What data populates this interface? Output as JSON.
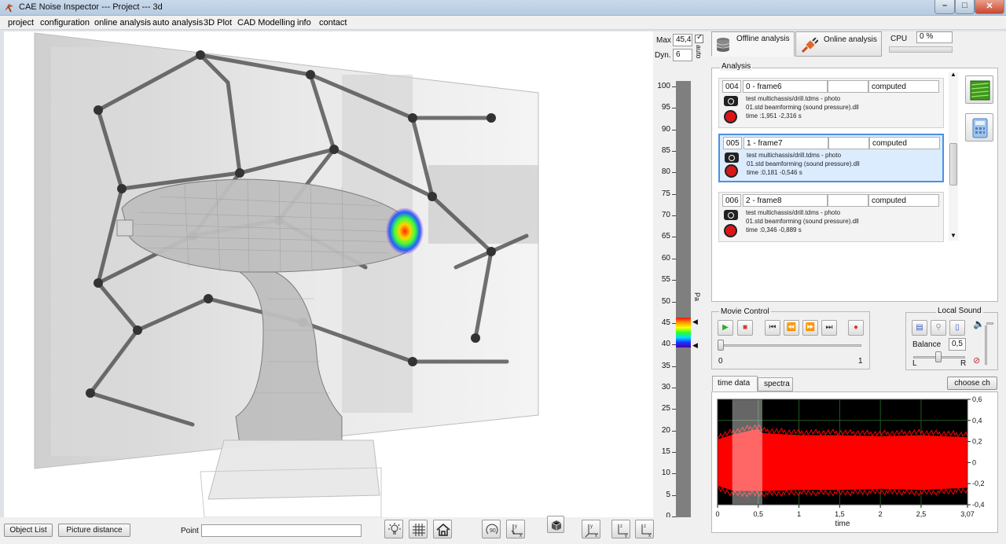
{
  "window": {
    "title": "CAE Noise Inspector --- Project ---  3d",
    "min_glyph": "–",
    "max_glyph": "□",
    "close_glyph": "✕"
  },
  "menu": [
    "project",
    "configuration",
    "online analysis",
    "auto analysis",
    "3D Plot",
    "CAD Modelling",
    "info",
    "contact"
  ],
  "scale": {
    "max_label": "Max",
    "max_value": "45,4",
    "dyn_label": "Dyn.",
    "dyn_value": "6",
    "auto_label": "auto",
    "unit": "Pa",
    "ticks": [
      "100",
      "95",
      "90",
      "85",
      "80",
      "75",
      "70",
      "65",
      "60",
      "55",
      "50",
      "45",
      "40",
      "35",
      "30",
      "25",
      "20",
      "15",
      "10",
      "5",
      "0"
    ]
  },
  "tabs": {
    "offline": "Offline analysis",
    "online": "Online analysis",
    "cpu_label": "CPU",
    "cpu_value": "0 %"
  },
  "analysis": {
    "title": "Analysis",
    "items": [
      {
        "id": "004",
        "name": "0 - frame6",
        "status": "computed",
        "line1": "test multichassis/drill.tdms - photo",
        "line2": "01.std beamforming (sound pressure).dll",
        "line3": "time :1,951 -2,316 s"
      },
      {
        "id": "005",
        "name": "1 - frame7",
        "status": "computed",
        "line1": "test multichassis/drill.tdms - photo",
        "line2": "01.std beamforming (sound pressure).dll",
        "line3": "time :0,181 -0,546 s"
      },
      {
        "id": "006",
        "name": "2 - frame8",
        "status": "computed",
        "line1": "test multichassis/drill.tdms - photo",
        "line2": "01.std beamforming (sound pressure).dll",
        "line3": "time :0,346 -0,889 s"
      }
    ]
  },
  "movie": {
    "title": "Movie Control",
    "slider_min": "0",
    "slider_max": "1"
  },
  "local_sound": {
    "title": "Local Sound",
    "balance_label": "Balance",
    "balance_value": "0,5",
    "left": "L",
    "right": "R"
  },
  "plot": {
    "tab_time": "time data",
    "tab_spectra": "spectra",
    "choose_button": "choose ch"
  },
  "chart_data": {
    "type": "line",
    "xlabel": "time",
    "ylabel": "",
    "xlim": [
      0,
      3.07
    ],
    "ylim": [
      -0.4,
      0.6
    ],
    "x_ticks": [
      "0",
      "0,5",
      "1",
      "1,5",
      "2",
      "2,5",
      "3,07"
    ],
    "y_ticks": [
      "0,6",
      "0,4",
      "0,2",
      "0",
      "-0,2",
      "-0,4"
    ],
    "series": [
      {
        "color": "#ff0000",
        "x": [
          0,
          0.2,
          0.5,
          0.55,
          1.0,
          1.5,
          2.0,
          2.5,
          3.07
        ],
        "y_max": [
          0.22,
          0.27,
          0.32,
          0.28,
          0.26,
          0.26,
          0.25,
          0.26,
          0.24
        ],
        "y_min": [
          -0.22,
          -0.27,
          -0.27,
          -0.27,
          -0.26,
          -0.26,
          -0.25,
          -0.26,
          -0.24
        ]
      }
    ],
    "selection": [
      0.18,
      0.55
    ],
    "grid": true
  },
  "bottom": {
    "object_list": "Object List",
    "picture_distance": "Picture distance",
    "point_label": "Point",
    "point_value": ""
  }
}
